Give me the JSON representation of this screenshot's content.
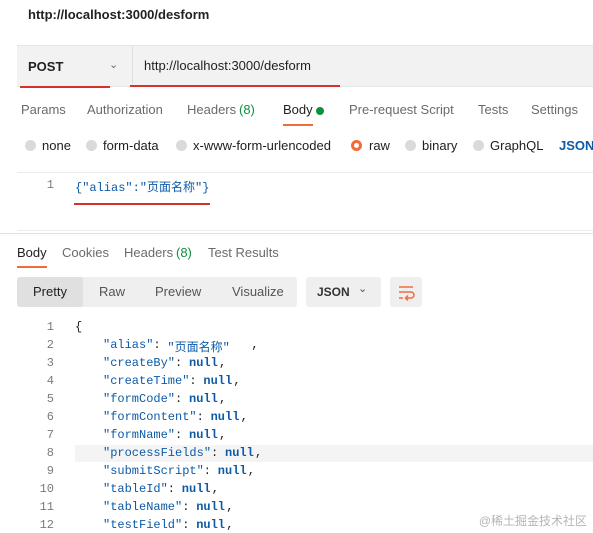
{
  "header": {
    "title": "http://localhost:3000/desform"
  },
  "request": {
    "method": "POST",
    "url": "http://localhost:3000/desform",
    "tabs": [
      "Params",
      "Authorization",
      "Headers",
      "(8)",
      "Body",
      "Pre-request Script",
      "Tests",
      "Settings"
    ],
    "body_modes": [
      "none",
      "form-data",
      "x-www-form-urlencoded",
      "raw",
      "binary",
      "GraphQL",
      "JSON"
    ],
    "selected_mode": "raw",
    "editor": {
      "line": "1",
      "code": "{\"alias\":\"页面名称\"}"
    }
  },
  "response": {
    "tabs": [
      "Body",
      "Cookies",
      "Headers",
      "(8)",
      "Test Results"
    ],
    "view_modes": [
      "Pretty",
      "Raw",
      "Preview",
      "Visualize"
    ],
    "format": "JSON",
    "lines": [
      {
        "n": "1",
        "t": "{"
      },
      {
        "n": "2",
        "k": "\"alias\"",
        "v": "\"页面名称\"",
        "vt": "s"
      },
      {
        "n": "3",
        "k": "\"createBy\"",
        "v": "null",
        "vt": "n"
      },
      {
        "n": "4",
        "k": "\"createTime\"",
        "v": "null",
        "vt": "n"
      },
      {
        "n": "5",
        "k": "\"formCode\"",
        "v": "null",
        "vt": "n"
      },
      {
        "n": "6",
        "k": "\"formContent\"",
        "v": "null",
        "vt": "n"
      },
      {
        "n": "7",
        "k": "\"formName\"",
        "v": "null",
        "vt": "n"
      },
      {
        "n": "8",
        "k": "\"processFields\"",
        "v": "null",
        "vt": "n"
      },
      {
        "n": "9",
        "k": "\"submitScript\"",
        "v": "null",
        "vt": "n"
      },
      {
        "n": "10",
        "k": "\"tableId\"",
        "v": "null",
        "vt": "n"
      },
      {
        "n": "11",
        "k": "\"tableName\"",
        "v": "null",
        "vt": "n"
      },
      {
        "n": "12",
        "k": "\"testField\"",
        "v": "null",
        "vt": "n"
      }
    ]
  },
  "watermark": "@稀土掘金技术社区",
  "colors": {
    "accent": "#f26b3a",
    "green": "#0c8f3f",
    "annotation_red": "#d0342c"
  }
}
